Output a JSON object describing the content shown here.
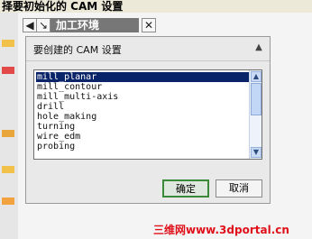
{
  "app": {
    "title": "择要初始化的 CAM 设置"
  },
  "navigator": {
    "tab_label": "加工环境",
    "left_glyph": "◀",
    "right_glyph": "↘",
    "close_glyph": "✕"
  },
  "dialog": {
    "title": "要创建的 CAM 设置",
    "collapse_glyph": "▲",
    "options": [
      "mill_planar",
      "mill_contour",
      "mill_multi-axis",
      "drill",
      "hole_making",
      "turning",
      "wire_edm",
      "probing"
    ],
    "selected": "mill_planar"
  },
  "buttons": {
    "ok": "确定",
    "cancel": "取消"
  },
  "watermark": {
    "text": "三维网www.3dportal.cn"
  },
  "colors": {
    "selection": "#0a246a",
    "tab": "#777777",
    "ok_border": "#3a8a3a",
    "watermark": "#e0101a"
  }
}
